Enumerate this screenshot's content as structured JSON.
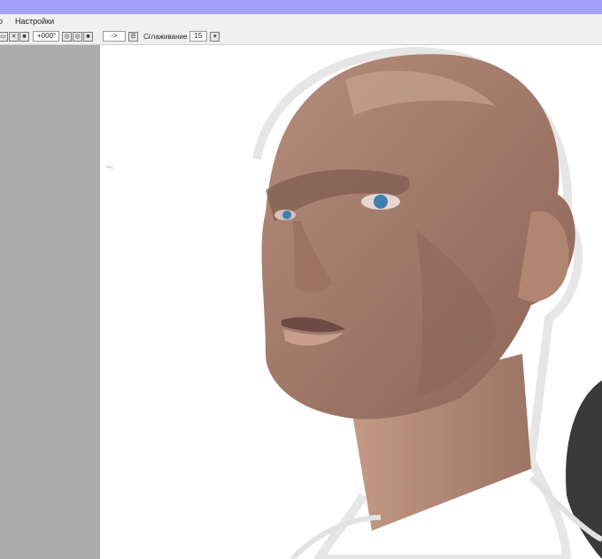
{
  "colors": {
    "titlebar": "#a3a0f8",
    "panel": "#ababab",
    "canvas": "#ffffff",
    "toolbar": "#f0f0f0"
  },
  "menu": {
    "items": [
      {
        "label": "о"
      },
      {
        "label": "Настройки"
      }
    ]
  },
  "toolbar": {
    "rotation_value": "+000°",
    "arrow_value": "->",
    "smoothing_label": "Сглаживание",
    "smoothing_value": "15"
  }
}
